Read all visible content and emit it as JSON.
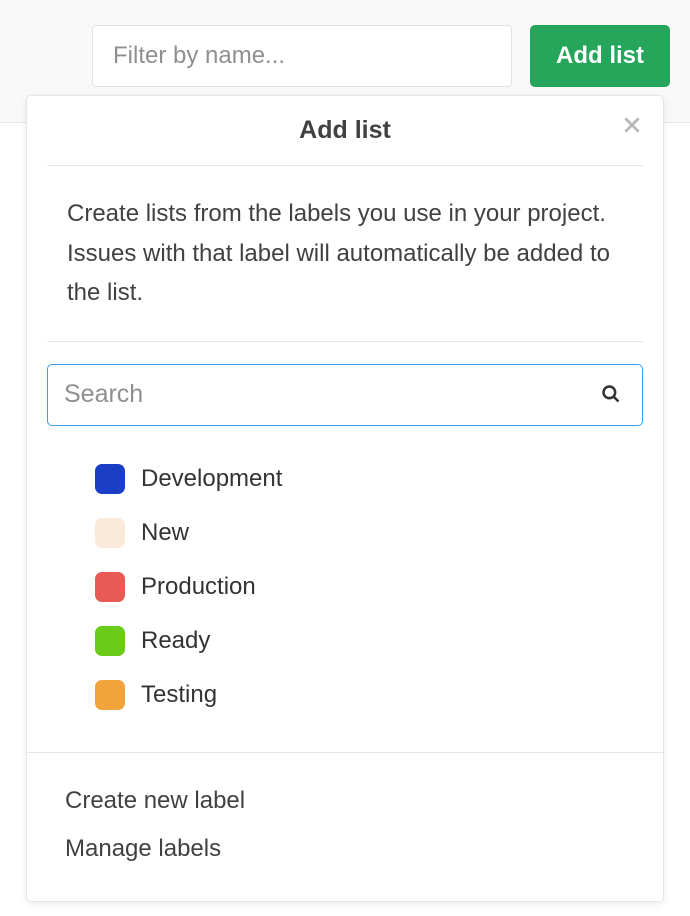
{
  "topbar": {
    "filter_placeholder": "Filter by name...",
    "add_list_label": "Add list"
  },
  "dropdown": {
    "title": "Add list",
    "description": "Create lists from the labels you use in your project. Issues with that label will automatically be added to the list.",
    "search_placeholder": "Search",
    "labels": [
      {
        "name": "Development",
        "color": "#1a3fc6"
      },
      {
        "name": "New",
        "color": "#fbe9da"
      },
      {
        "name": "Production",
        "color": "#e85a53"
      },
      {
        "name": "Ready",
        "color": "#6acb18"
      },
      {
        "name": "Testing",
        "color": "#f1a33c"
      }
    ],
    "footer": {
      "create_label": "Create new label",
      "manage_labels": "Manage labels"
    }
  }
}
